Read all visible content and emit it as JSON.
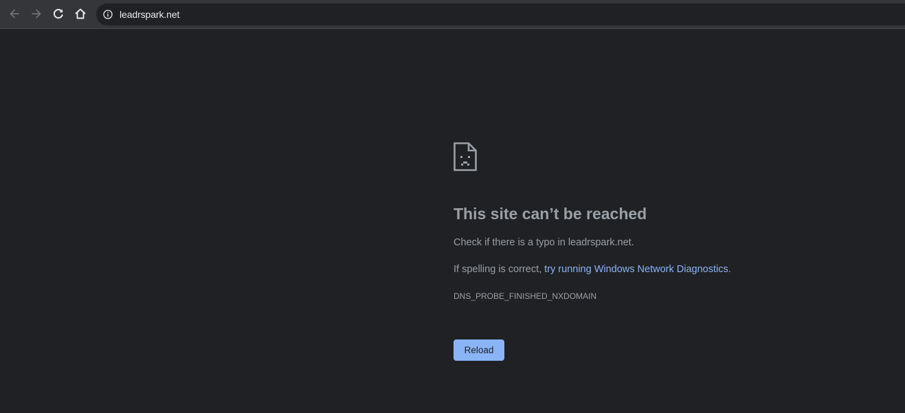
{
  "browser": {
    "url": "leadrspark.net",
    "icons": {
      "back": "arrow-left-icon",
      "forward": "arrow-right-icon",
      "reload": "reload-icon",
      "home": "home-icon",
      "site_info": "info-icon"
    }
  },
  "error": {
    "icon": "sad-page-icon",
    "title": "This site can’t be reached",
    "line1": "Check if there is a typo in leadrspark.net.",
    "line2_prefix": "If spelling is correct, ",
    "line2_link": "try running Windows Network Diagnostics",
    "line2_suffix": ".",
    "code": "DNS_PROBE_FINISHED_NXDOMAIN",
    "reload_label": "Reload"
  },
  "colors": {
    "page_background": "#202124",
    "toolbar_background": "#35363a",
    "text_secondary": "#9aa0a6",
    "link": "#8ab4f8",
    "button_background": "#8ab4f8"
  }
}
